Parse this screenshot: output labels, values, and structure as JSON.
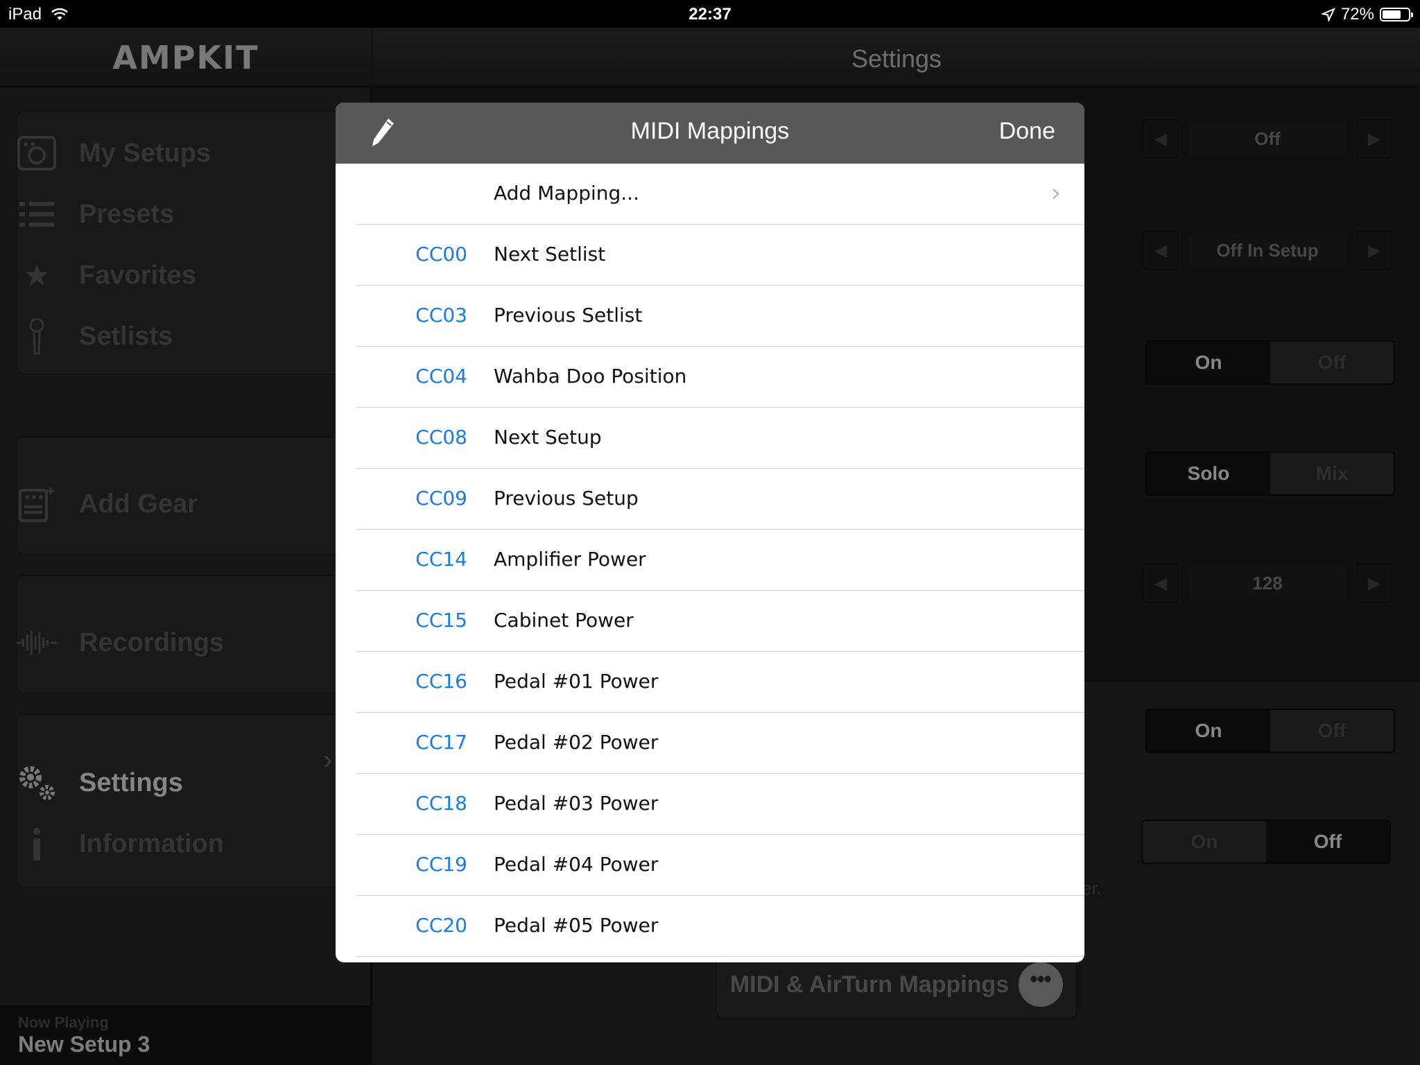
{
  "status_bar": {
    "device": "iPad",
    "time": "22:37",
    "battery_percent": "72%",
    "battery_level": 0.72
  },
  "sidebar": {
    "logo": "AMPKIT",
    "items": [
      {
        "label": "My Setups",
        "icon": "camera-box-icon"
      },
      {
        "label": "Presets",
        "icon": "list-icon"
      },
      {
        "label": "Favorites",
        "icon": "star-icon"
      },
      {
        "label": "Setlists",
        "icon": "microphone-icon"
      },
      {
        "label": "Add Gear",
        "icon": "add-pedal-icon"
      },
      {
        "label": "Recordings",
        "icon": "waveform-icon"
      },
      {
        "label": "Settings",
        "icon": "gears-icon",
        "active": true
      },
      {
        "label": "Information",
        "icon": "info-icon"
      }
    ],
    "now_playing_label": "Now Playing",
    "now_playing_value": "New Setup 3"
  },
  "main": {
    "title": "Settings",
    "stepper1_value": "Off",
    "stepper2_value": "Off In Setup",
    "segment1": {
      "left": "On",
      "right": "Off",
      "selected": "left"
    },
    "segment2": {
      "left": "Solo",
      "right": "Mix",
      "selected": "left"
    },
    "stepper3_value": "128",
    "segment3": {
      "left": "On",
      "right": "Off",
      "selected": "left"
    },
    "segment4": {
      "left": "On",
      "right": "Off",
      "selected": "right"
    },
    "footnote_fragment": "er.",
    "midi_button_label": "MIDI & AirTurn Mappings"
  },
  "modal": {
    "title": "MIDI Mappings",
    "done_label": "Done",
    "add_mapping_label": "Add Mapping...",
    "mappings": [
      {
        "code": "CC00",
        "label": "Next Setlist"
      },
      {
        "code": "CC03",
        "label": "Previous Setlist"
      },
      {
        "code": "CC04",
        "label": "Wahba Doo Position"
      },
      {
        "code": "CC08",
        "label": "Next Setup"
      },
      {
        "code": "CC09",
        "label": "Previous Setup"
      },
      {
        "code": "CC14",
        "label": "Amplifier Power"
      },
      {
        "code": "CC15",
        "label": "Cabinet Power"
      },
      {
        "code": "CC16",
        "label": "Pedal #01 Power"
      },
      {
        "code": "CC17",
        "label": "Pedal #02 Power"
      },
      {
        "code": "CC18",
        "label": "Pedal #03 Power"
      },
      {
        "code": "CC19",
        "label": "Pedal #04 Power"
      },
      {
        "code": "CC20",
        "label": "Pedal #05 Power"
      }
    ]
  },
  "colors": {
    "accent_blue": "#1a7ce6",
    "modal_header": "#585858",
    "background": "#1c1c1e"
  }
}
